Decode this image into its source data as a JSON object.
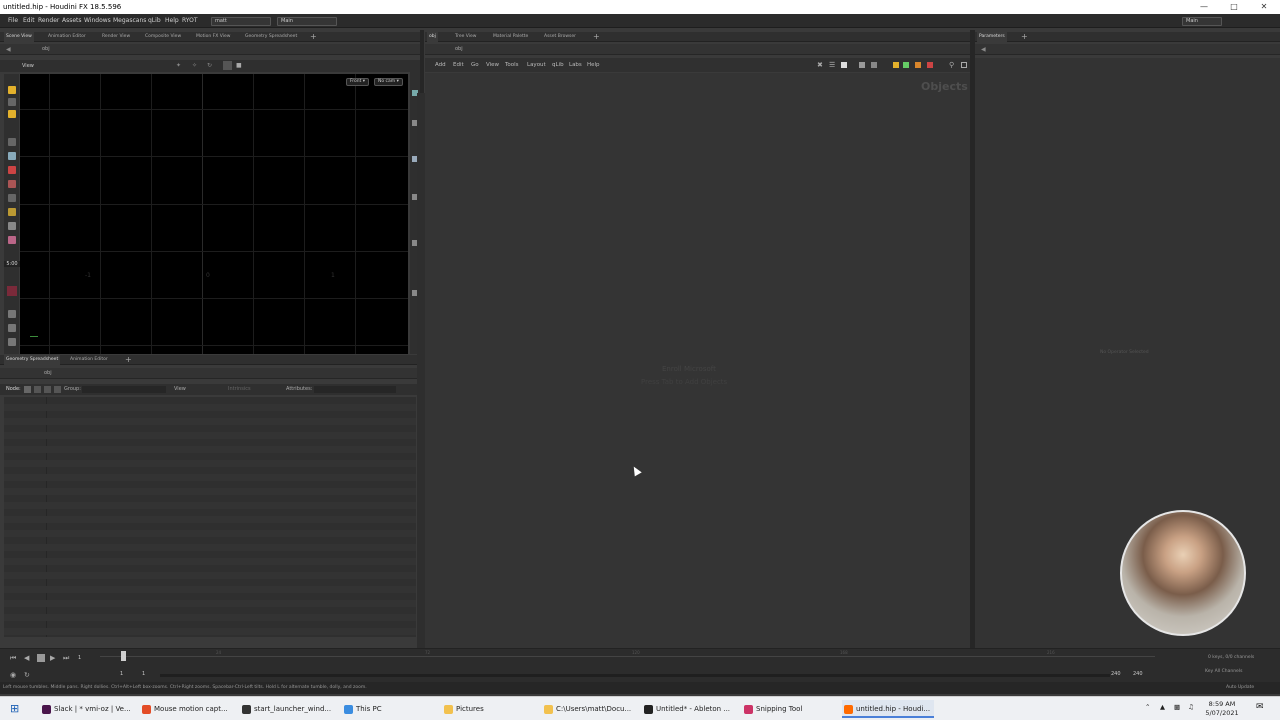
{
  "window": {
    "title": "untitled.hip - Houdini FX 18.5.596"
  },
  "menu": {
    "items": [
      "File",
      "Edit",
      "Render",
      "Assets",
      "Windows",
      "Megascans",
      "qLib",
      "Help",
      "RYOT"
    ],
    "desktop_user": "matt",
    "desktop_main": "Main",
    "right_main": "Main"
  },
  "left_top_tabs": [
    "Scene View",
    "Animation Editor",
    "Render View",
    "Composite View",
    "Motion FX View",
    "Geometry Spreadsheet"
  ],
  "viewport": {
    "path": "obj",
    "label": "View",
    "front_btn": "Front ▾",
    "cam_btn": "No cam ▾",
    "axis_labels": [
      "-1",
      "0",
      "1"
    ],
    "time_badge": "5:00"
  },
  "left_bottom_tabs": [
    "Geometry Spreadsheet",
    "Animation Editor"
  ],
  "sheet": {
    "path": "obj",
    "node_label": "Node:",
    "group_label": "Group:",
    "view_label": "View",
    "intrinsics_label": "Intrinsics",
    "attributes_label": "Attributes:"
  },
  "network": {
    "tabs": [
      "obj",
      "Tree View",
      "Material Palette",
      "Asset Browser"
    ],
    "path": "obj",
    "menu": [
      "Add",
      "Edit",
      "Go",
      "View",
      "Tools",
      "Layout",
      "qLib",
      "Labs",
      "Help"
    ],
    "context_label": "Objects",
    "hint_line1": "Enroll Microsoft",
    "hint_line2": "Press Tab to Add Objects"
  },
  "params": {
    "tabs": [
      "Parameters"
    ],
    "empty_text": "No Operator Selected"
  },
  "timeline": {
    "frame_field": "1",
    "start": "1",
    "start2": "1",
    "end": "240",
    "end2": "240",
    "ticks": [
      "24",
      "72",
      "120",
      "168",
      "216"
    ],
    "keys_info": "0 keys, 0/0 channels",
    "key_all": "Key All Channels",
    "auto_update": "Auto Update"
  },
  "status_text": "Left mouse tumbles. Middle pans. Right dollies. Ctrl+Alt+Left box-zooms. Ctrl+Right zooms. Spacebar-Ctrl-Left tilts. Hold L for alternate tumble, dolly, and zoom.",
  "taskbar": {
    "items": [
      {
        "label": "Slack | * vmi-oz | Ve...",
        "color": "#4a154b"
      },
      {
        "label": "Mouse motion capt...",
        "color": "#e34c26"
      },
      {
        "label": "start_launcher_wind...",
        "color": "#333333"
      },
      {
        "label": "This PC",
        "color": "#3b8de0"
      },
      {
        "label": "Pictures",
        "color": "#f2c14e"
      },
      {
        "label": "C:\\Users\\matt\\Docu...",
        "color": "#f2c14e"
      },
      {
        "label": "Untitled* - Ableton ...",
        "color": "#222222"
      },
      {
        "label": "Snipping Tool",
        "color": "#cc3366"
      },
      {
        "label": "untitled.hip - Houdi...",
        "color": "#ff6a00"
      }
    ],
    "time": "8:59 AM",
    "date": "5/07/2021"
  },
  "colors": {
    "accent": "#ff6a00",
    "viewport_bg": "#000000",
    "panel_bg": "#343434"
  }
}
